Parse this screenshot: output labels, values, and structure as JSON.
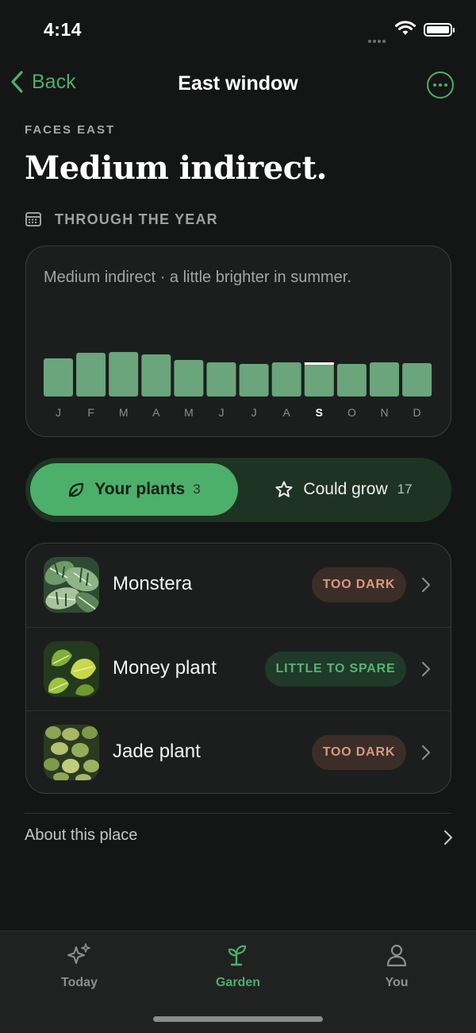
{
  "status": {
    "time": "4:14"
  },
  "nav": {
    "back_label": "Back",
    "title": "East window"
  },
  "header": {
    "eyebrow": "FACES EAST",
    "headline": "Medium indirect."
  },
  "section": {
    "label": "THROUGH THE YEAR"
  },
  "chart_card": {
    "description": "Medium indirect · a little brighter in summer."
  },
  "chart_data": {
    "type": "bar",
    "categories": [
      "J",
      "F",
      "M",
      "A",
      "M",
      "J",
      "J",
      "A",
      "S",
      "O",
      "N",
      "D"
    ],
    "values": [
      48,
      55,
      56,
      53,
      46,
      43,
      41,
      43,
      42,
      41,
      43,
      42
    ],
    "highlight_index": 8,
    "ylim": [
      0,
      100
    ],
    "xlabel": "",
    "ylabel": "",
    "colors": {
      "bar": "#6aa57c",
      "highlight_tick": "#ffffff",
      "label": "#8c8f8d",
      "label_active": "#ffffff"
    }
  },
  "segmented": {
    "your_plants": {
      "label": "Your plants",
      "count": "3"
    },
    "could_grow": {
      "label": "Could grow",
      "count": "17"
    }
  },
  "plants": [
    {
      "name": "Monstera",
      "badge": "TOO DARK",
      "thumb": "monstera"
    },
    {
      "name": "Money plant",
      "badge": "LITTLE TO SPARE",
      "thumb": "money"
    },
    {
      "name": "Jade plant",
      "badge": "TOO DARK",
      "thumb": "jade"
    }
  ],
  "about": {
    "label": "About this place"
  },
  "tabs": [
    {
      "label": "Today",
      "icon": "sparkles-icon"
    },
    {
      "label": "Garden",
      "icon": "sprout-icon",
      "active": true
    },
    {
      "label": "You",
      "icon": "person-icon"
    }
  ],
  "colors": {
    "accent": "#4caf6a",
    "background": "#141615",
    "card": "#1c1e1d",
    "too_dark_text": "#d99a7f",
    "spare_text": "#57b473"
  }
}
